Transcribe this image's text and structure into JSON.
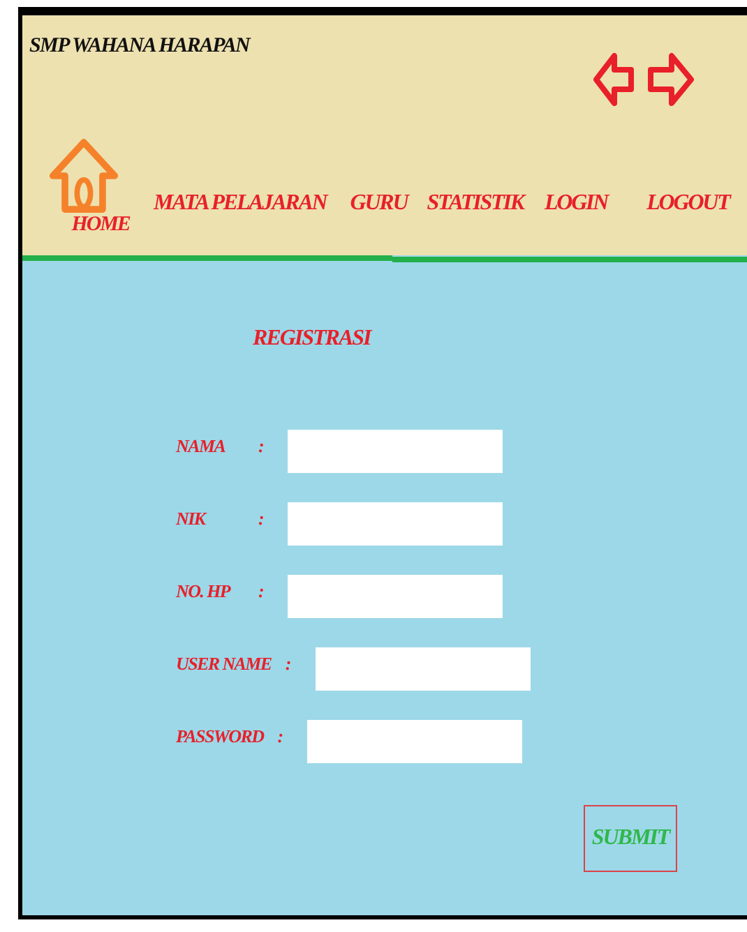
{
  "site_title": "SMP WAHANA HARAPAN",
  "nav": [
    {
      "label": "HOME",
      "kind": "home"
    },
    {
      "label": "MATA PELAJARAN",
      "kind": "link"
    },
    {
      "label": "GURU",
      "kind": "link"
    },
    {
      "label": "STATISTIK",
      "kind": "link"
    },
    {
      "label": "LOGIN",
      "kind": "link"
    },
    {
      "label": "LOGOUT",
      "kind": "link"
    }
  ],
  "form": {
    "title": "REGISTRASI",
    "fields": [
      {
        "label": "NAMA",
        "separator": ":"
      },
      {
        "label": "NIK",
        "separator": ":"
      },
      {
        "label": "NO. HP",
        "separator": ":"
      },
      {
        "label": "USER NAME",
        "separator": ":"
      },
      {
        "label": "PASSWORD",
        "separator": ":"
      }
    ],
    "submit": "SUBMIT"
  }
}
